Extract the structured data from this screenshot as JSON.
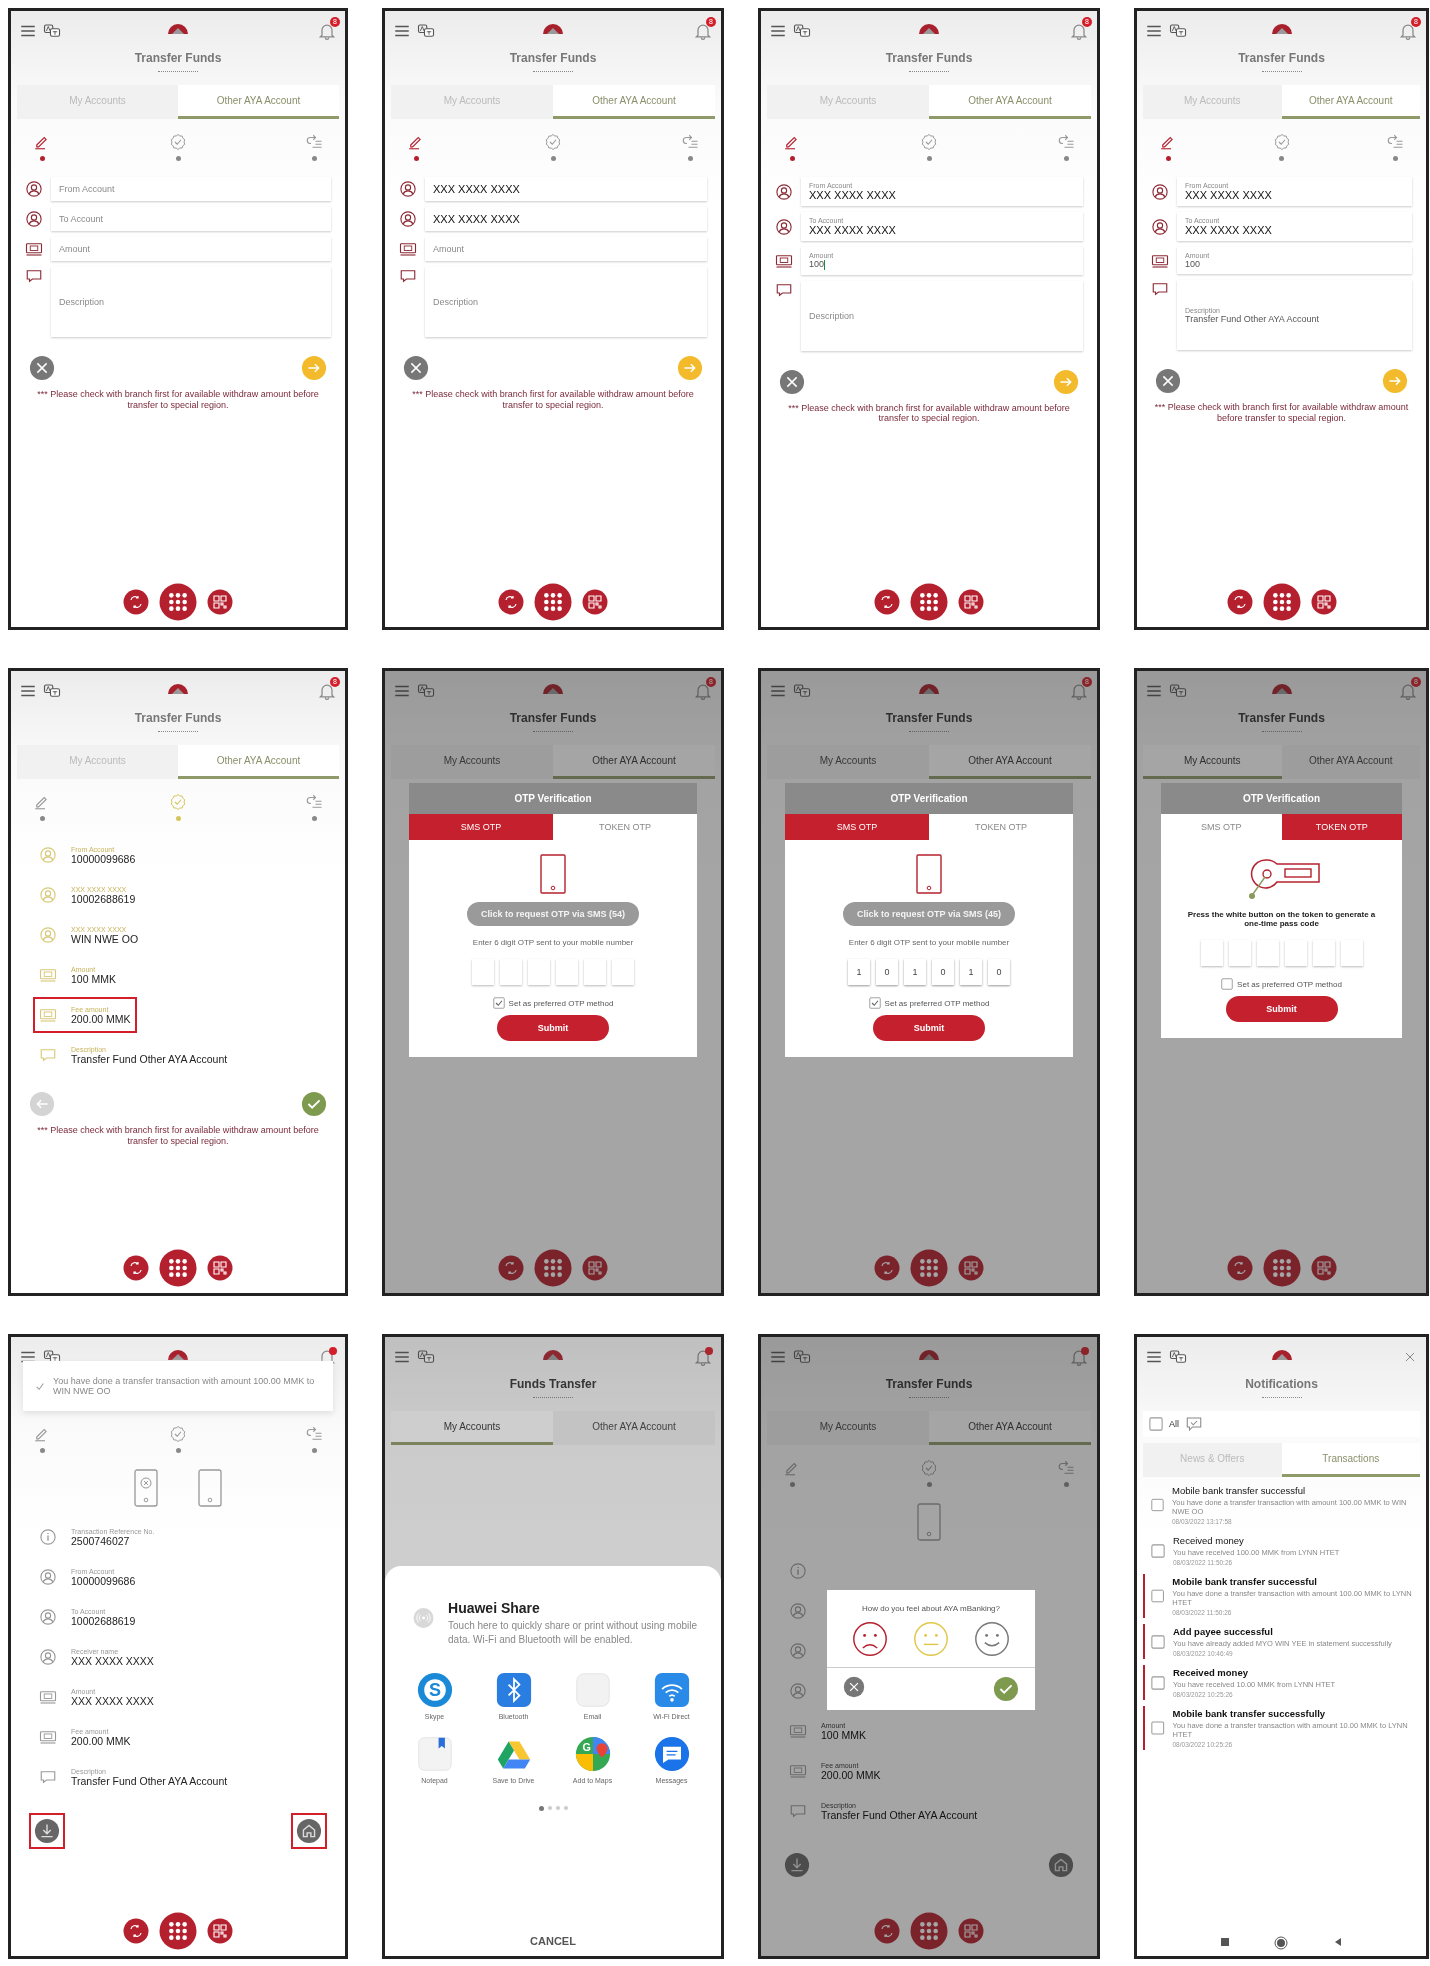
{
  "panels": [
    {
      "kind": "form",
      "header": {
        "trailing": {
          "kind": "bell",
          "badge": "8"
        },
        "title": "Transfer Funds"
      },
      "tabs": [
        {
          "label": "My Accounts",
          "selected": false
        },
        {
          "label": "Other AYA Account",
          "selected": true
        }
      ],
      "steps": [
        {
          "selected": true
        },
        {
          "selected": false
        },
        {
          "selected": false
        }
      ],
      "fields": [
        {
          "kind": "person",
          "placeholder": "From Account"
        },
        {
          "kind": "person",
          "placeholder": "To Account"
        },
        {
          "kind": "cash",
          "placeholder": "Amount"
        },
        {
          "kind": "note",
          "placeholder": "Description"
        }
      ],
      "actions": [
        {
          "kind": "cancel"
        },
        {
          "kind": "next"
        }
      ],
      "note": "*** Please check with branch first for available withdraw amount before transfer to special region.",
      "bottom_nav": true
    },
    {
      "kind": "form",
      "header": {
        "trailing": {
          "kind": "bell",
          "badge": "8"
        },
        "title": "Transfer Funds"
      },
      "tabs": [
        {
          "label": "My Accounts",
          "selected": false
        },
        {
          "label": "Other AYA Account",
          "selected": true
        }
      ],
      "steps": [
        {
          "selected": true
        },
        {
          "selected": false
        },
        {
          "selected": false
        }
      ],
      "fields": [
        {
          "kind": "person",
          "value": "XXX XXXX XXXX"
        },
        {
          "kind": "person",
          "value": "XXX XXXX XXXX"
        },
        {
          "kind": "cash",
          "placeholder": "Amount"
        },
        {
          "kind": "note",
          "placeholder": "Description"
        }
      ],
      "actions": [
        {
          "kind": "cancel"
        },
        {
          "kind": "next"
        }
      ],
      "note": "*** Please check with branch first for available withdraw amount before transfer to special region.",
      "bottom_nav": true
    },
    {
      "kind": "form",
      "header": {
        "trailing": {
          "kind": "bell",
          "badge": "8"
        },
        "title": "Transfer Funds"
      },
      "tabs": [
        {
          "label": "My Accounts",
          "selected": false
        },
        {
          "label": "Other AYA Account",
          "selected": true
        }
      ],
      "steps": [
        {
          "selected": true
        },
        {
          "selected": false
        },
        {
          "selected": false
        }
      ],
      "fields": [
        {
          "kind": "person",
          "label": "From Account",
          "value": "XXX XXXX XXXX"
        },
        {
          "kind": "person",
          "label": "To Account",
          "value": "XXX XXXX XXXX"
        },
        {
          "kind": "cash",
          "label": "Amount",
          "value": "100",
          "focused": true
        },
        {
          "kind": "note",
          "placeholder": "Description"
        }
      ],
      "actions": [
        {
          "kind": "cancel"
        },
        {
          "kind": "next"
        }
      ],
      "note": "*** Please check with branch first for available withdraw amount before transfer to special region.",
      "bottom_nav": true
    },
    {
      "kind": "form",
      "header": {
        "trailing": {
          "kind": "bell",
          "badge": "8"
        },
        "title": "Transfer Funds"
      },
      "tabs": [
        {
          "label": "My Accounts",
          "selected": false
        },
        {
          "label": "Other AYA Account",
          "selected": true
        }
      ],
      "steps": [
        {
          "selected": true
        },
        {
          "selected": false
        },
        {
          "selected": false
        }
      ],
      "fields": [
        {
          "kind": "person",
          "label": "From Account",
          "value": "XXX XXXX XXXX"
        },
        {
          "kind": "person",
          "label": "To Account",
          "value": "XXX XXXX XXXX"
        },
        {
          "kind": "cash",
          "label": "Amount",
          "value": "100"
        },
        {
          "kind": "note",
          "label": "Description",
          "value": "Transfer Fund Other AYA Account"
        }
      ],
      "actions": [
        {
          "kind": "cancel"
        },
        {
          "kind": "next"
        }
      ],
      "note": "*** Please check with branch first for available withdraw amount before transfer to special region.",
      "bottom_nav": true
    },
    {
      "kind": "review",
      "header": {
        "trailing": {
          "kind": "bell",
          "badge": "8"
        },
        "title": "Transfer Funds"
      },
      "tabs": [
        {
          "label": "My Accounts",
          "selected": false
        },
        {
          "label": "Other AYA Account",
          "selected": true
        }
      ],
      "steps": [
        {
          "selected": false
        },
        {
          "selected": true
        },
        {
          "selected": false
        }
      ],
      "rows": [
        {
          "kind": "person",
          "label": "From Account",
          "value": "10000099686",
          "highlighted": false
        },
        {
          "kind": "person",
          "label": "XXX XXXX XXXX",
          "value": "10002688619",
          "highlighted": false
        },
        {
          "kind": "person",
          "label": "XXX XXXX XXXX",
          "value": "WIN NWE OO",
          "highlighted": false
        },
        {
          "kind": "cash",
          "label": "Amount",
          "value": "100 MMK",
          "highlighted": false
        },
        {
          "kind": "cash",
          "label": "Fee amount",
          "value": "200.00 MMK",
          "highlighted": true
        },
        {
          "kind": "note",
          "label": "Description",
          "value": "Transfer Fund Other AYA Account",
          "highlighted": false
        }
      ],
      "actions": [
        {
          "kind": "back"
        },
        {
          "kind": "confirm"
        }
      ],
      "note": "*** Please check with branch first for available withdraw amount before transfer to special region.",
      "bottom_nav": true
    },
    {
      "kind": "blank",
      "dimmed": true,
      "header": {
        "trailing": {
          "kind": "bell",
          "badge": "8"
        },
        "title": "Transfer Funds"
      },
      "tabs": [
        {
          "label": "My Accounts",
          "selected": false
        },
        {
          "label": "Other AYA Account",
          "selected": true
        }
      ],
      "bottom_nav": true,
      "modal": {
        "kind": "otp_sms",
        "title": "OTP Verification",
        "tabs": [
          {
            "label": "SMS OTP",
            "selected": true
          },
          {
            "label": "TOKEN OTP",
            "selected": false
          }
        ],
        "request": {
          "label": "Click to request OTP via SMS (54)",
          "disabled": true
        },
        "instruction": "Enter 6 digit OTP sent to your mobile number",
        "digits": [
          {
            "filled": false
          },
          {
            "filled": false
          },
          {
            "filled": false
          },
          {
            "filled": false
          },
          {
            "filled": false
          },
          {
            "filled": false
          }
        ],
        "preferred": {
          "label": "Set as preferred OTP method",
          "checked": true
        },
        "submit": "Submit"
      }
    },
    {
      "kind": "blank",
      "dimmed": true,
      "header": {
        "trailing": {
          "kind": "bell",
          "badge": "8"
        },
        "title": "Transfer Funds"
      },
      "tabs": [
        {
          "label": "My Accounts",
          "selected": false
        },
        {
          "label": "Other AYA Account",
          "selected": true
        }
      ],
      "bottom_nav": true,
      "modal": {
        "kind": "otp_sms",
        "title": "OTP Verification",
        "tabs": [
          {
            "label": "SMS OTP",
            "selected": true
          },
          {
            "label": "TOKEN OTP",
            "selected": false
          }
        ],
        "request": {
          "label": "Click to request OTP via SMS (45)",
          "disabled": true
        },
        "instruction": "Enter 6 digit OTP sent to your mobile number",
        "digits": [
          {
            "filled": true,
            "value": "1"
          },
          {
            "filled": true,
            "value": "0"
          },
          {
            "filled": true,
            "value": "1"
          },
          {
            "filled": true,
            "value": "0"
          },
          {
            "filled": true,
            "value": "1"
          },
          {
            "filled": true,
            "value": "0"
          }
        ],
        "preferred": {
          "label": "Set as preferred OTP method",
          "checked": true
        },
        "submit": "Submit"
      }
    },
    {
      "kind": "blank",
      "dimmed": true,
      "header": {
        "trailing": {
          "kind": "bell",
          "badge": "8"
        },
        "title": "Transfer Funds"
      },
      "tabs": [
        {
          "label": "My Accounts",
          "selected": true
        },
        {
          "label": "Other AYA Account",
          "selected": false
        }
      ],
      "bottom_nav": true,
      "modal": {
        "kind": "otp_token",
        "title": "OTP Verification",
        "tabs": [
          {
            "label": "SMS OTP",
            "selected": false
          },
          {
            "label": "TOKEN OTP",
            "selected": true
          }
        ],
        "instruction": "Press the white button on the token to generate a one-time pass code",
        "digits": [
          {
            "filled": false
          },
          {
            "filled": false
          },
          {
            "filled": false
          },
          {
            "filled": false
          },
          {
            "filled": false
          },
          {
            "filled": false
          }
        ],
        "preferred": {
          "label": "Set as preferred OTP method",
          "checked": false
        },
        "submit": "Submit"
      }
    },
    {
      "kind": "result",
      "header": {
        "trailing": {
          "kind": "bell_dot"
        }
      },
      "steps": [
        {
          "selected": false
        },
        {
          "selected": false
        },
        {
          "selected": false
        }
      ],
      "toast": "You have done a transfer transaction with amount 100.00 MMK to WIN NWE OO",
      "devices": [
        {
          "kind": "phone_x"
        },
        {
          "kind": "phone"
        }
      ],
      "rows": [
        {
          "kind": "info",
          "label": "Transaction Reference No.",
          "value": "2500746027"
        },
        {
          "kind": "person",
          "label": "From Account",
          "value": "10000099686"
        },
        {
          "kind": "person",
          "label": "To Account",
          "value": "10002688619"
        },
        {
          "kind": "person",
          "label": "Receiver name",
          "value": "XXX XXXX XXXX"
        },
        {
          "kind": "cash",
          "label": "Amount",
          "value": "XXX XXXX XXXX"
        },
        {
          "kind": "cash",
          "label": "Fee amount",
          "value": "200.00 MMK"
        },
        {
          "kind": "note",
          "label": "Description",
          "value": "Transfer Fund Other AYA Account"
        }
      ],
      "actions": [
        {
          "kind": "download",
          "highlighted": true
        },
        {
          "kind": "home",
          "highlighted": true
        }
      ],
      "bottom_nav": true
    },
    {
      "kind": "blank",
      "dimmed": true,
      "header": {
        "trailing": {
          "kind": "bell_dot"
        },
        "title": "Funds Transfer"
      },
      "tabs": [
        {
          "label": "My Accounts",
          "selected": true
        },
        {
          "label": "Other AYA Account",
          "selected": false
        }
      ],
      "modal": {
        "kind": "share",
        "title": "Huawei Share",
        "text": "Touch here to quickly share or print without using mobile data. Wi-Fi and Bluetooth will be enabled.",
        "apps": [
          {
            "kind": "skype",
            "label": "Skype",
            "glyph": "S"
          },
          {
            "kind": "bluetooth",
            "label": "Bluetooth"
          },
          {
            "kind": "email",
            "label": "Email"
          },
          {
            "kind": "wifi",
            "label": "Wi-Fi Direct"
          },
          {
            "kind": "notepad",
            "label": "Notepad"
          },
          {
            "kind": "drive",
            "label": "Save to Drive"
          },
          {
            "kind": "maps",
            "label": "Add to Maps",
            "glyph": "G"
          },
          {
            "kind": "messages",
            "label": "Messages"
          }
        ],
        "pages": [
          {
            "selected": true
          },
          {
            "selected": false
          },
          {
            "selected": false
          },
          {
            "selected": false
          }
        ],
        "cancel": "CANCEL"
      }
    },
    {
      "kind": "result",
      "dimmed": true,
      "header": {
        "trailing": {
          "kind": "bell_dot"
        },
        "title": "Transfer Funds"
      },
      "tabs": [
        {
          "label": "My Accounts",
          "selected": false
        },
        {
          "label": "Other AYA Account",
          "selected": true
        }
      ],
      "steps": [
        {
          "selected": false
        },
        {
          "selected": false
        },
        {
          "selected": false
        }
      ],
      "devices": [
        {
          "kind": "phone"
        }
      ],
      "rows": [
        {
          "kind": "info"
        },
        {
          "kind": "person"
        },
        {
          "kind": "person"
        },
        {
          "kind": "person"
        },
        {
          "kind": "cash",
          "label": "Amount",
          "value": "100 MMK"
        },
        {
          "kind": "cash",
          "label": "Fee amount",
          "value": "200.00 MMK"
        },
        {
          "kind": "note",
          "label": "Description",
          "value": "Transfer Fund Other AYA Account"
        }
      ],
      "actions": [
        {
          "kind": "download",
          "highlighted": false
        },
        {
          "kind": "home",
          "highlighted": false
        }
      ],
      "bottom_nav": true,
      "modal": {
        "kind": "feedback",
        "question": "How do you feel about AYA mBanking?",
        "faces": [
          {
            "kind": "sad"
          },
          {
            "kind": "neutral"
          },
          {
            "kind": "happy"
          }
        ]
      }
    },
    {
      "kind": "notifications",
      "header": {
        "trailing": {
          "kind": "close"
        },
        "title": "Notifications"
      },
      "filter": {
        "label": "All",
        "checked": false
      },
      "tabs": [
        {
          "label": "News & Offers",
          "selected": false
        },
        {
          "label": "Transactions",
          "selected": true
        }
      ],
      "items": [
        {
          "title": "Mobile bank transfer successful",
          "body": "You have done a transfer transaction with amount 100.00 MMK to WIN NWE OO",
          "time": "08/03/2022 13:17:58",
          "unread": false,
          "checked": false
        },
        {
          "title": "Received money",
          "body": "You have received 100.00 MMK from LYNN HTET",
          "time": "08/03/2022 11:50:26",
          "unread": false,
          "checked": false
        },
        {
          "title": "Mobile bank transfer successful",
          "body": "You have done a transfer transaction with amount 100.00 MMK to LYNN HTET",
          "time": "08/03/2022 11:50:26",
          "unread": true,
          "checked": false
        },
        {
          "title": "Add payee successful",
          "body": "You have already added MYO WIN YEE in statement successfully",
          "time": "08/03/2022 10:46:49",
          "unread": true,
          "checked": false
        },
        {
          "title": "Received money",
          "body": "You have received 10.00 MMK from LYNN HTET",
          "time": "08/03/2022 10:25:26",
          "unread": true,
          "checked": false
        },
        {
          "title": "Mobile bank transfer successfully",
          "body": "You have done a transfer transaction with amount 10.00 MMK to LYNN HTET",
          "time": "08/03/2022 10:25:26",
          "unread": true,
          "checked": false
        }
      ],
      "system_nav": true
    }
  ]
}
